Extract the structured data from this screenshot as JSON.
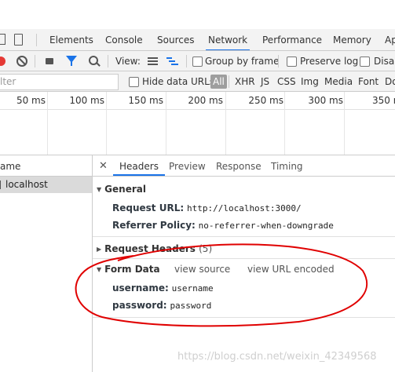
{
  "main_tabs": [
    "Elements",
    "Console",
    "Sources",
    "Network",
    "Performance",
    "Memory",
    "Ap"
  ],
  "toolbar": {
    "view_label": "View:",
    "group_by_frame": "Group by frame",
    "preserve_log": "Preserve log",
    "disable_cache": "Disab"
  },
  "filter": {
    "placeholder": "lter",
    "hide_data_urls": "Hide data URLs",
    "all": "All",
    "types": [
      "XHR",
      "JS",
      "CSS",
      "Img",
      "Media",
      "Font",
      "Do"
    ]
  },
  "timeline": {
    "ticks": [
      "50 ms",
      "100 ms",
      "150 ms",
      "200 ms",
      "250 ms",
      "300 ms",
      "350 m"
    ]
  },
  "requests": {
    "name_header": "ame",
    "rows": [
      "localhost"
    ]
  },
  "detail_tabs": [
    "Headers",
    "Preview",
    "Response",
    "Timing"
  ],
  "general": {
    "title": "General",
    "request_url_label": "Request URL:",
    "request_url_value": "http://localhost:3000/",
    "referrer_label": "Referrer Policy:",
    "referrer_value": "no-referrer-when-downgrade"
  },
  "request_headers": {
    "title": "Request Headers",
    "count": "(5)"
  },
  "form_data": {
    "title": "Form Data",
    "view_source": "view source",
    "view_url_encoded": "view URL encoded",
    "fields": [
      {
        "key": "username:",
        "value": "username"
      },
      {
        "key": "password:",
        "value": "password"
      }
    ]
  },
  "watermark": "https://blog.csdn.net/weixin_42349568",
  "colors": {
    "accent": "#1a73e8",
    "record": "#e53935",
    "annotation": "#e00000"
  }
}
